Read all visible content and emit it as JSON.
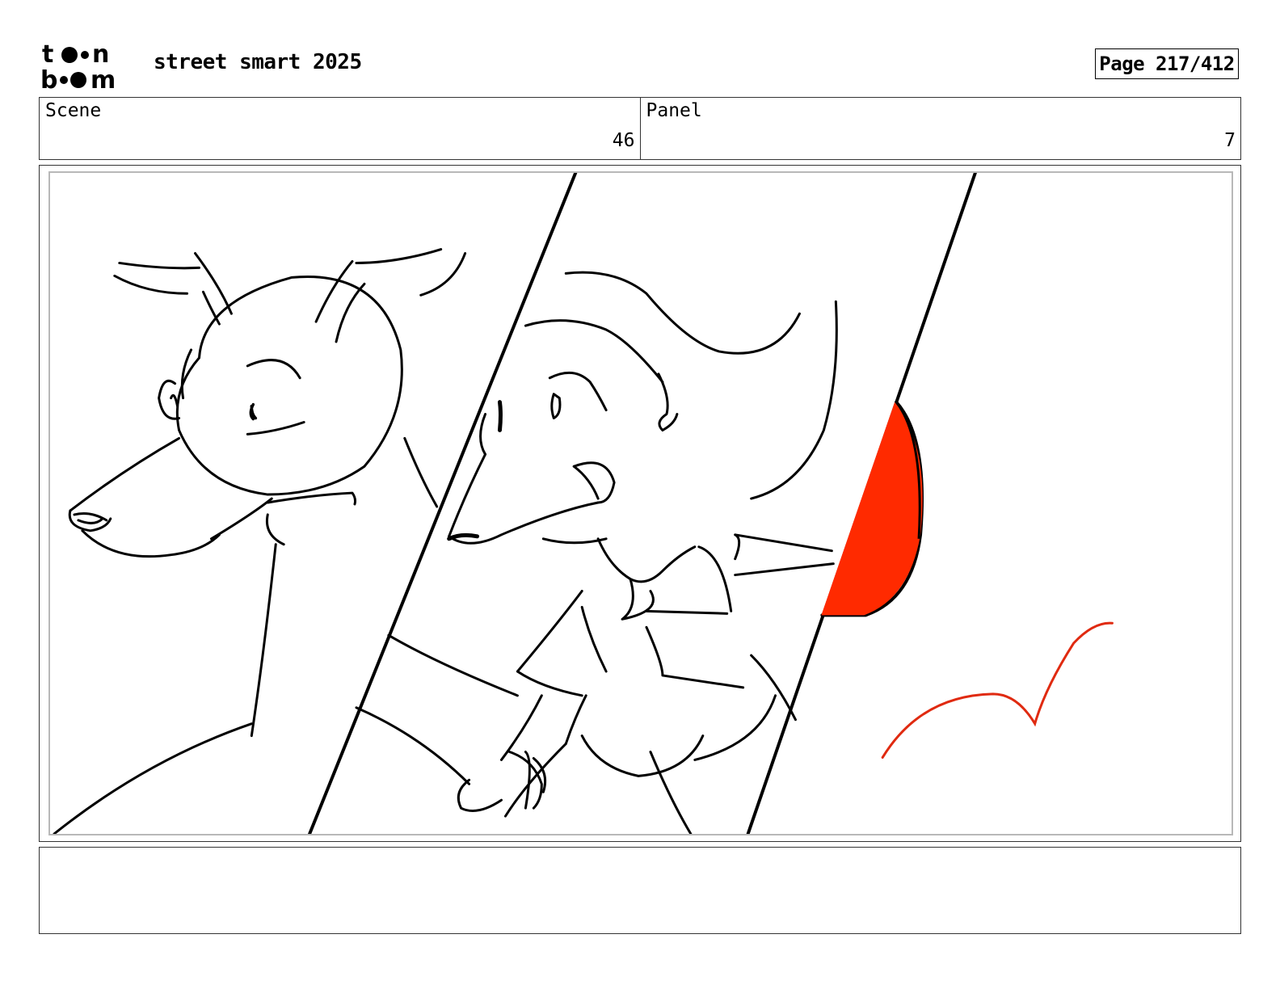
{
  "header": {
    "logo_text": "toon boom",
    "project_title": "street smart 2025",
    "page_label": "Page 217/412"
  },
  "scene": {
    "label": "Scene",
    "value": "46"
  },
  "panel": {
    "label": "Panel",
    "value": "7"
  },
  "caption": {
    "text": ""
  },
  "colors": {
    "sketch_line": "#000000",
    "accent_red": "#ff2a00",
    "frame_gray": "#b8b8b8"
  }
}
